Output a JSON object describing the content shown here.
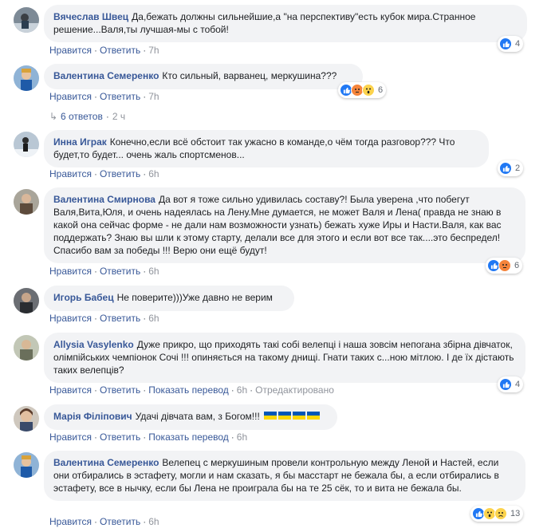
{
  "comments": [
    {
      "author": "Вячеслав Швец",
      "text": "Да,бежать должны сильнейшие,а \"на перспективу\"есть кубок мира.Странное решение...Валя,ты лучшая-мы с тобой!",
      "like": "Нравится",
      "reply": "Ответить",
      "time": "7h",
      "reactions": "4"
    },
    {
      "author": "Валентина Семеренко",
      "text": "Кто сильный, варванец, меркушина???",
      "like": "Нравится",
      "reply": "Ответить",
      "time": "7h",
      "reactions": "6"
    },
    {
      "author": "Инна Играк",
      "text": "Конечно,если всё обстоит так ужасно в команде,о чём тогда разговор??? Что будет,то будет... очень жаль спортсменов...",
      "like": "Нравится",
      "reply": "Ответить",
      "time": "6h",
      "reactions": "2"
    },
    {
      "author": "Валентина Смирнова",
      "text": "Да вот я тоже сильно удивилась составу?! Была уверена ,что побегут Валя,Вита,Юля, и очень надеялась на Лену.Мне думается, не может Валя и Лена( правда не знаю в какой она сейчас форме - не дали нам возможности узнать) бежать хуже Иры и Насти.Валя, как вас поддержать? Знаю вы шли к этому старту, делали все для этого и если вот все так....это беспредел! Спасибо вам за победы !!! Верю они ещё будут!",
      "like": "Нравится",
      "reply": "Ответить",
      "time": "6h",
      "reactions": "6"
    },
    {
      "author": "Игорь Бабец",
      "text": "Не поверите)))Уже давно не верим",
      "like": "Нравится",
      "reply": "Ответить",
      "time": "6h"
    },
    {
      "author": "Allysia Vasylenko",
      "text": "Дуже прикро, що приходять такі собі велепці і наша зовсім непогана збірна дівчаток, олімпійських чемпіонок Сочі !!! опиняється на такому днищі. Гнати таких с...ною мітлою. І де їх дістають таких велепців?",
      "like": "Нравится",
      "reply": "Ответить",
      "translate": "Показать перевод",
      "time": "6h",
      "edited": "Отредактировано",
      "reactions": "4"
    },
    {
      "author": "Марія Філіпович",
      "text": "Удачі дівчата вам, з Богом!!!",
      "like": "Нравится",
      "reply": "Ответить",
      "translate": "Показать перевод",
      "time": "6h"
    },
    {
      "author": "Валентина Семеренко",
      "text": "Велепец с меркушиным провели контрольную между Леной и Настей, если они отбирались в эстафету, могли и нам сказать, я бы масстарт не бежала бы, а если отбирались в эстафету, все в нычку, если бы Лена не проиграла бы на те 25 сёк, то и вита не бежала бы.",
      "like": "Нравится",
      "reply": "Ответить",
      "time": "6h",
      "reactions": "13"
    }
  ],
  "replies": {
    "label": "6 ответов",
    "time": "2 ч"
  },
  "colors": {
    "link": "#385898",
    "bubble": "#f2f3f5",
    "like": "#2078f4",
    "ukraine_blue": "#0057b7",
    "ukraine_yellow": "#ffd700"
  }
}
